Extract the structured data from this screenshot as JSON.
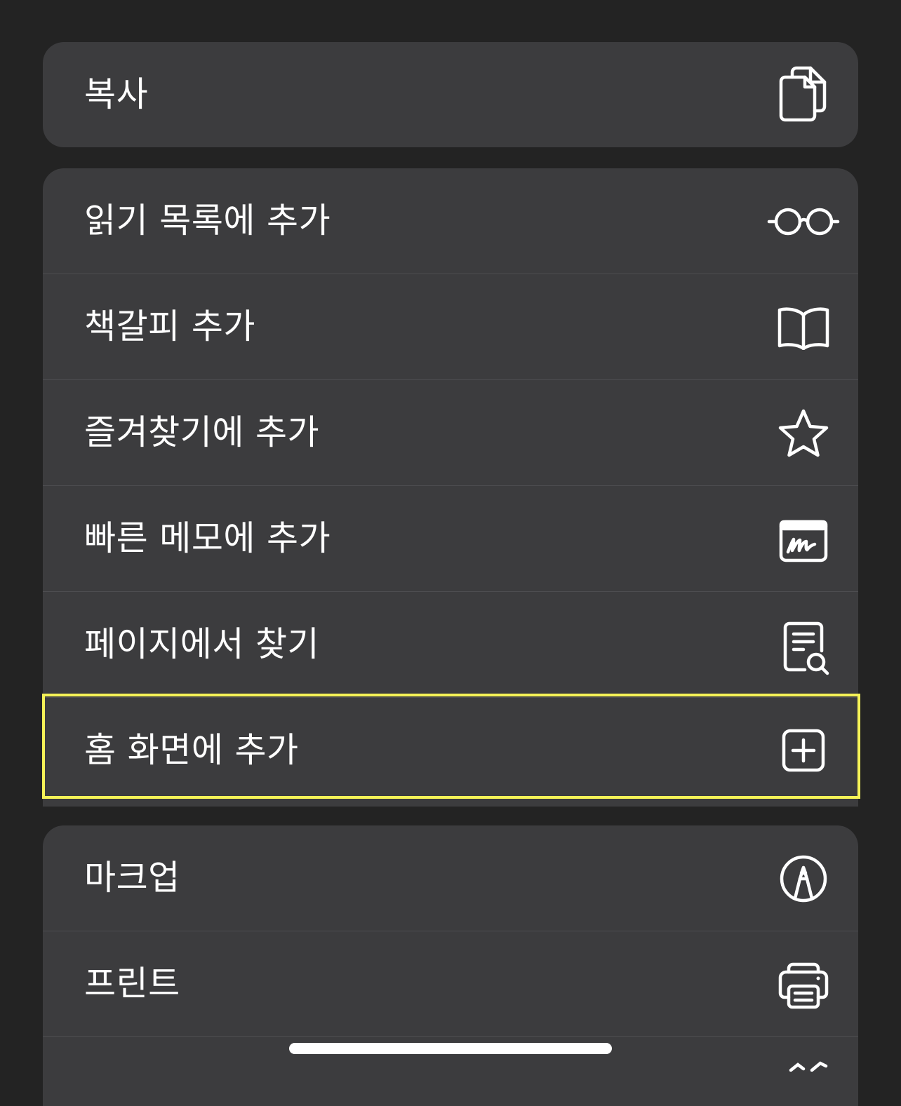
{
  "groups": [
    {
      "items": [
        {
          "label": "복사",
          "icon": "copy-icon"
        }
      ]
    },
    {
      "items": [
        {
          "label": "읽기 목록에 추가",
          "icon": "glasses-icon"
        },
        {
          "label": "책갈피 추가",
          "icon": "book-icon"
        },
        {
          "label": "즐겨찾기에 추가",
          "icon": "star-icon"
        },
        {
          "label": "빠른 메모에 추가",
          "icon": "quick-note-icon"
        },
        {
          "label": "페이지에서 찾기",
          "icon": "find-in-page-icon"
        },
        {
          "label": "홈 화면에 추가",
          "icon": "add-square-icon",
          "highlighted": true
        }
      ]
    },
    {
      "items": [
        {
          "label": "마크업",
          "icon": "markup-icon"
        },
        {
          "label": "프린트",
          "icon": "printer-icon"
        },
        {
          "label": "",
          "icon": "partial-icon"
        }
      ]
    }
  ],
  "colors": {
    "background": "#232323",
    "group_background": "#3c3c3e",
    "separator": "#4d4d50",
    "text": "#ffffff",
    "highlight": "#f5f257"
  }
}
